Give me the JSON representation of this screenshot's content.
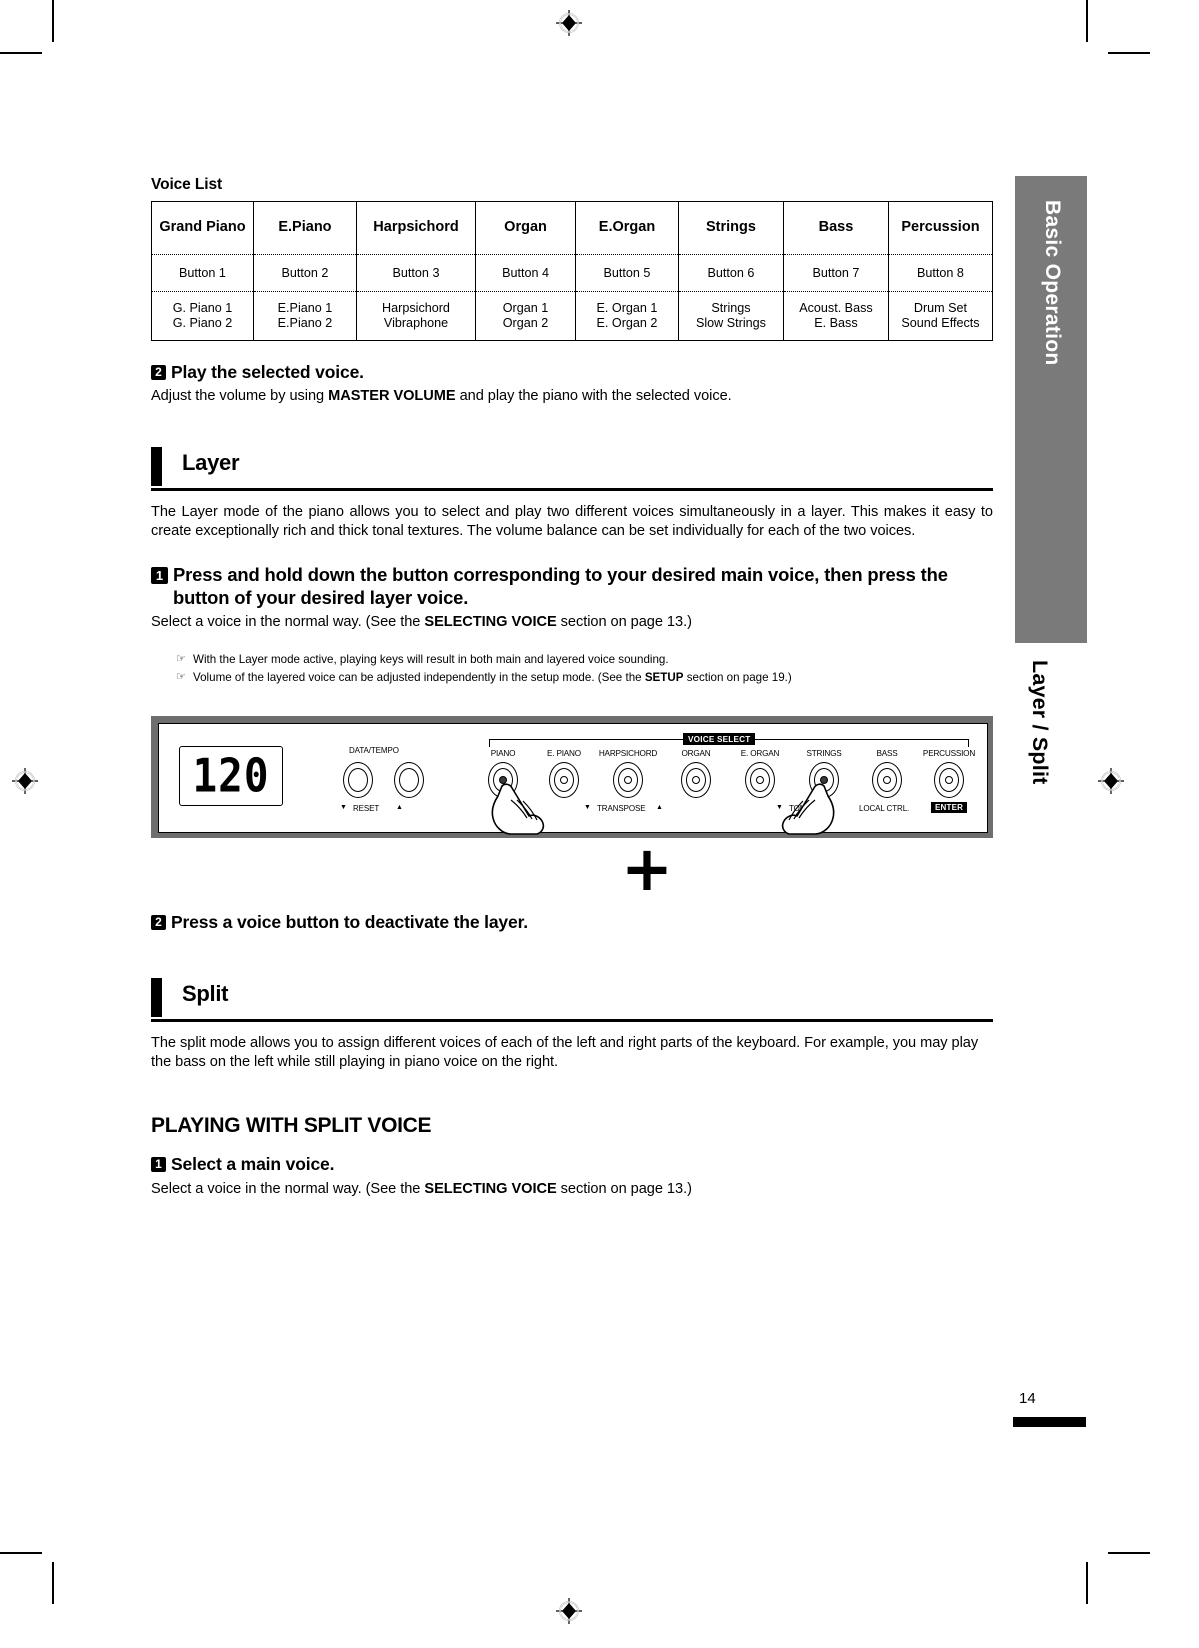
{
  "voice_list": {
    "title": "Voice List",
    "columns": [
      {
        "header": "Grand\nPiano",
        "header_line1": "Grand",
        "header_line2": "Piano",
        "button": "Button 1",
        "voice1": "G. Piano 1",
        "voice2": "G. Piano 2"
      },
      {
        "header": "E.Piano",
        "header_line1": "E.Piano",
        "header_line2": "",
        "button": "Button 2",
        "voice1": "E.Piano 1",
        "voice2": "E.Piano 2"
      },
      {
        "header": "Harpsichord",
        "header_line1": "Harpsichord",
        "header_line2": "",
        "button": "Button 3",
        "voice1": "Harpsichord",
        "voice2": "Vibraphone"
      },
      {
        "header": "Organ",
        "header_line1": "Organ",
        "header_line2": "",
        "button": "Button 4",
        "voice1": "Organ 1",
        "voice2": "Organ 2"
      },
      {
        "header": "E.Organ",
        "header_line1": "E.Organ",
        "header_line2": "",
        "button": "Button 5",
        "voice1": "E. Organ 1",
        "voice2": "E. Organ 2"
      },
      {
        "header": "Strings",
        "header_line1": "Strings",
        "header_line2": "",
        "button": "Button 6",
        "voice1": "Strings",
        "voice2": "Slow Strings"
      },
      {
        "header": "Bass",
        "header_line1": "Bass",
        "header_line2": "",
        "button": "Button 7",
        "voice1": "Acoust. Bass",
        "voice2": "E. Bass"
      },
      {
        "header": "Percussion",
        "header_line1": "Percussion",
        "header_line2": "",
        "button": "Button 8",
        "voice1": "Drum Set",
        "voice2": "Sound Effects"
      }
    ]
  },
  "step_play": {
    "number": "2",
    "title": "Play the selected voice.",
    "body_pre": "Adjust the volume by using ",
    "body_bold": "MASTER VOLUME",
    "body_post": " and play the piano with the selected voice."
  },
  "layer_section": {
    "heading": "Layer",
    "intro": "The Layer mode of the piano allows you to select and play two different voices simultaneously in a layer. This makes it easy to create exceptionally rich and thick tonal textures. The volume balance can be set individually for each of the two voices.",
    "step1": {
      "number": "1",
      "title_line1": "Press and hold down the button corresponding to your desired main voice,",
      "title_line2": "then press the button of your desired layer voice.",
      "body_pre": "Select a voice in the normal way. (See the ",
      "body_bold": "SELECTING VOICE",
      "body_post": " section on page 13.)"
    },
    "notes": [
      {
        "icon": "pointing-hand",
        "text": "With the Layer mode active, playing keys will result in both main and layered voice sounding."
      },
      {
        "icon": "pointing-hand",
        "text_pre": "Volume of the layered voice can be  adjusted independently in the setup mode. (See the ",
        "text_bold": "SETUP",
        "text_post": " section on page 19.)"
      }
    ],
    "step2": {
      "number": "2",
      "title": "Press a voice button to deactivate the layer."
    },
    "plus_symbol": "+"
  },
  "panel": {
    "display_value": "120",
    "data_tempo_label": "DATA/TEMPO",
    "voice_select_label": "VOICE SELECT",
    "reset_label": "RESET",
    "transpose_label": "TRANSPOSE",
    "local_ctrl_label": "LOCAL CTRL.",
    "enter_label": "ENTER",
    "tone_label": "TONE",
    "down_triangle": "▼",
    "up_triangle": "▲",
    "voice_buttons": [
      {
        "label": "PIANO",
        "active": true
      },
      {
        "label": "E. PIANO",
        "active": false
      },
      {
        "label": "HARPSICHORD",
        "active": false
      },
      {
        "label": "ORGAN",
        "active": false
      },
      {
        "label": "E. ORGAN",
        "active": false
      },
      {
        "label": "STRINGS",
        "active": true
      },
      {
        "label": "BASS",
        "active": false
      },
      {
        "label": "PERCUSSION",
        "active": false
      }
    ]
  },
  "split_section": {
    "heading": "Split",
    "intro": "The split mode allows you to assign different voices of each of the left and right parts of the keyboard. For example, you may play the bass on the left while still playing in piano voice on the right.",
    "big_title": "PLAYING WITH SPLIT VOICE",
    "step1": {
      "number": "1",
      "title": "Select a main voice.",
      "body_pre": "Select a voice in the normal way. (See the ",
      "body_bold": "SELECTING VOICE",
      "body_post": " section on page 13.)"
    }
  },
  "sidebar": {
    "tab_label": "Basic Operation",
    "section_label": "Layer / Split"
  },
  "footer": {
    "page_number": "14"
  }
}
